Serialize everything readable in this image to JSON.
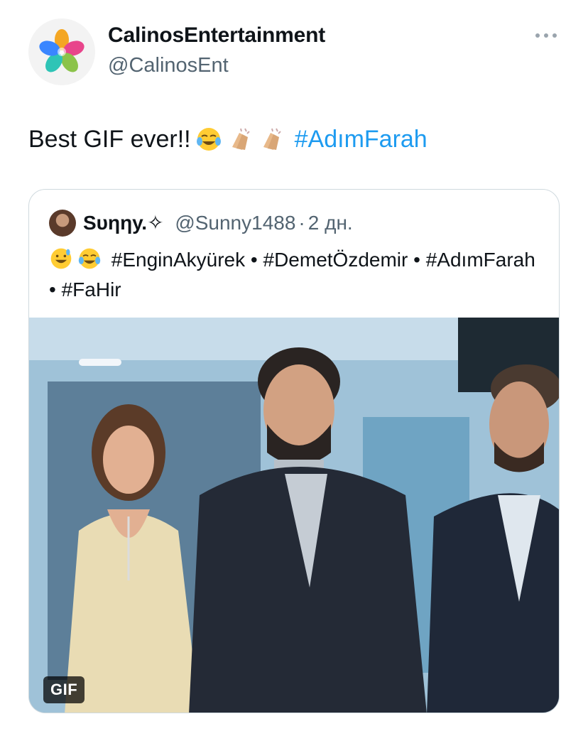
{
  "author": {
    "display_name": "CalinosEntertainment",
    "handle": "@CalinosEnt",
    "avatar_icon": "flower-logo-icon"
  },
  "more_icon": "more-options-icon",
  "tweet": {
    "text": "Best GIF ever!!",
    "emojis": [
      "face-with-tears-of-joy",
      "clapping-hands",
      "clapping-hands"
    ],
    "hashtag": "#AdımFarah"
  },
  "quote": {
    "display_name": "Sυηηу.✧",
    "handle": "@Sunny1488",
    "separator": "·",
    "time": "2 дн.",
    "emojis": [
      "grinning-face-with-sweat",
      "face-with-tears-of-joy"
    ],
    "hashtags": [
      "#EnginAkyürek",
      "#DemetÖzdemir",
      "#AdımFarah",
      "#FaHir"
    ],
    "bullet": "•",
    "media_badge": "GIF"
  },
  "colors": {
    "link": "#1d9bf0",
    "secondary_text": "#536471",
    "border": "#cfd9de"
  }
}
